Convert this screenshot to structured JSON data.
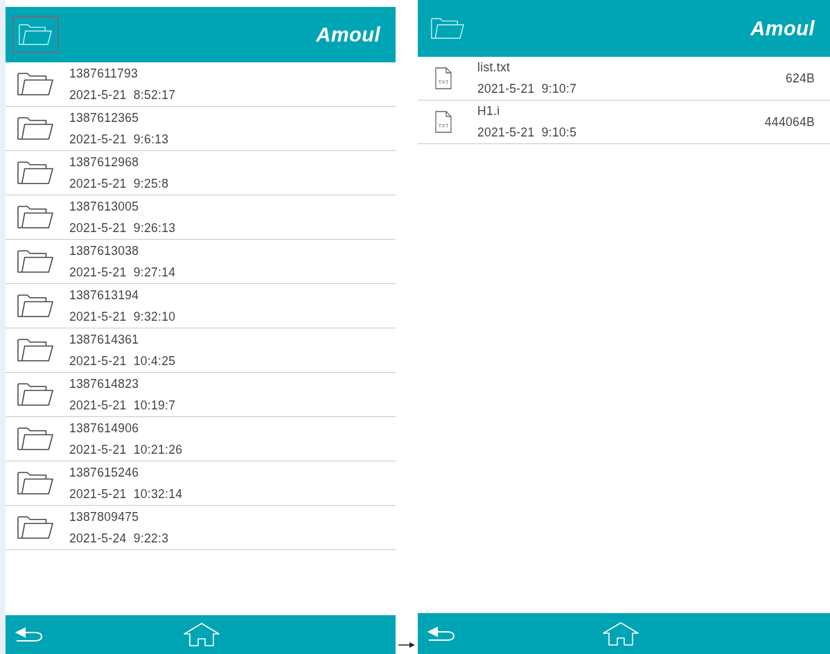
{
  "left_screen": {
    "header": {
      "folder_button": {
        "focused": true
      },
      "logo_text": "Amoul"
    },
    "folders": [
      {
        "name": "1387611793",
        "date": "2021-5-21  8:52:17"
      },
      {
        "name": "1387612365",
        "date": "2021-5-21  9:6:13"
      },
      {
        "name": "1387612968",
        "date": "2021-5-21  9:25:8"
      },
      {
        "name": "1387613005",
        "date": "2021-5-21  9:26:13"
      },
      {
        "name": "1387613038",
        "date": "2021-5-21  9:27:14"
      },
      {
        "name": "1387613194",
        "date": "2021-5-21  9:32:10"
      },
      {
        "name": "1387614361",
        "date": "2021-5-21  10:4:25"
      },
      {
        "name": "1387614823",
        "date": "2021-5-21  10:19:7"
      },
      {
        "name": "1387614906",
        "date": "2021-5-21  10:21:26"
      },
      {
        "name": "1387615246",
        "date": "2021-5-21  10:32:14"
      },
      {
        "name": "1387809475",
        "date": "2021-5-24  9:22:3"
      }
    ]
  },
  "right_screen": {
    "header": {
      "folder_button": {
        "focused": false
      },
      "logo_text": "Amoul"
    },
    "files": [
      {
        "icon_label": "TXT",
        "name": "list.txt",
        "date": "2021-5-21  9:10:7",
        "size": "624B"
      },
      {
        "icon_label": "TXT",
        "name": "H1.i",
        "date": "2021-5-21  9:10:5",
        "size": "444064B"
      }
    ]
  }
}
